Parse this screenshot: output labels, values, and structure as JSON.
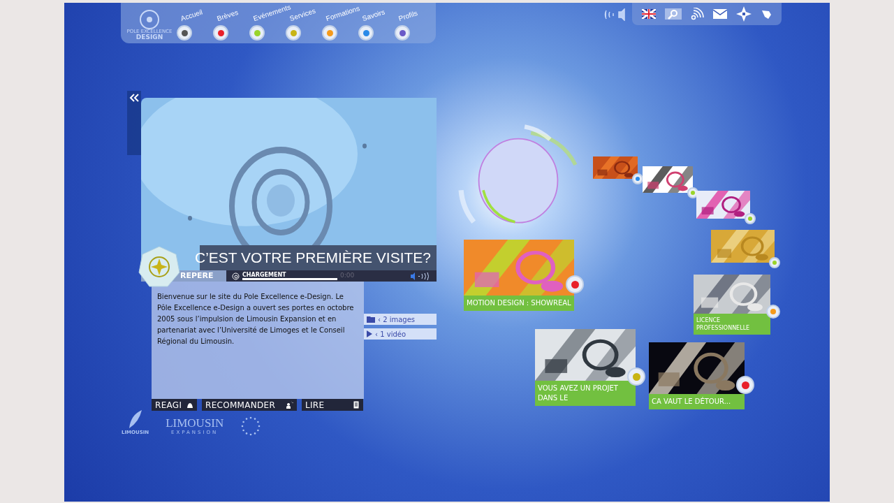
{
  "logo": {
    "line1": "POLE EXCELLENCE",
    "line2": "DESIGN"
  },
  "nav": [
    {
      "label": "Accueil",
      "color": "#555555"
    },
    {
      "label": "Brèves",
      "color": "#e8202a"
    },
    {
      "label": "Evénements",
      "color": "#9ad42a"
    },
    {
      "label": "Services",
      "color": "#c8b414"
    },
    {
      "label": "Formations",
      "color": "#f59a1a"
    },
    {
      "label": "Savoirs",
      "color": "#2a8ae8"
    },
    {
      "label": "Profils",
      "color": "#6a5ac8"
    }
  ],
  "feature": {
    "title": "C’EST VOTRE PREMIÈRE VISITE?",
    "badge": "REPERE",
    "loading": "CHARGEMENT",
    "level": 1,
    "time": "0:00",
    "text": "Bienvenue sur le site du Pole Excellence e-Design. Le Pôle Excellence e-Design a ouvert ses portes en octobre 2005 sous l’impulsion de Limousin Expansion et en partenariat avec l’Université de Limoges et le Conseil Régional du Limousin.",
    "media": [
      {
        "kind": "images",
        "label": "‹ 2 images"
      },
      {
        "kind": "video",
        "label": "‹ 1 vidéo"
      }
    ],
    "actions": [
      {
        "kind": "react",
        "label": "REAGI"
      },
      {
        "kind": "recommend",
        "label": "RECOMMANDER"
      },
      {
        "kind": "read",
        "label": "LIRE"
      }
    ]
  },
  "tiles": [
    {
      "kind": "picture",
      "color": "#2a8ae8"
    },
    {
      "kind": "picture",
      "color": "#9ad42a"
    },
    {
      "kind": "picture",
      "color": "#9ad42a"
    },
    {
      "kind": "picture",
      "color": "#9ad42a"
    },
    {
      "kind": "card",
      "title": "MOTION DESIGN : SHOWREAL",
      "color": "#e8202a"
    },
    {
      "kind": "card",
      "title": "LICENCE PROFESSIONNELLE",
      "color": "#f59a1a"
    },
    {
      "kind": "card",
      "title": "VOUS AVEZ UN PROJET DANS LE",
      "color": "#c8b414"
    },
    {
      "kind": "card",
      "title": "CA VAUT LE DÉTOUR...",
      "color": "#e8202a"
    }
  ],
  "partners": [
    {
      "name": "LIMOUSIN"
    },
    {
      "name": "LIMOUSIN",
      "sub": "EXPANSION"
    }
  ]
}
